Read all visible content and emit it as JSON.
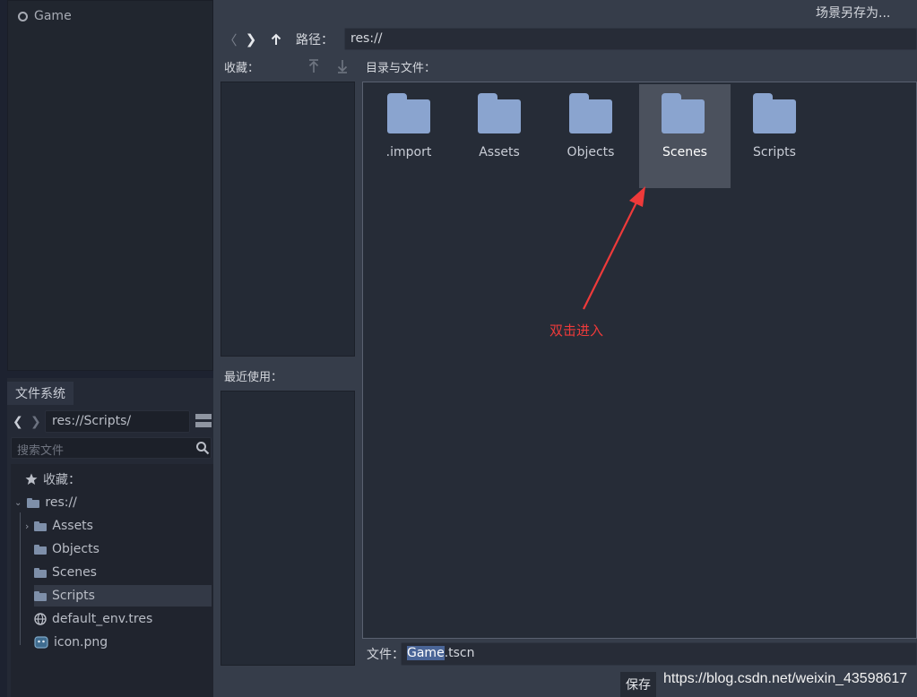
{
  "scene_tree": {
    "root_node": "Game"
  },
  "filesystem": {
    "tab_label": "文件系统",
    "current_path": "res://Scripts/",
    "search_placeholder": "搜索文件",
    "tree": {
      "favorites_label": "收藏：",
      "root_label": "res://",
      "items": [
        {
          "label": "Assets",
          "icon": "folder-icon",
          "expandable": true
        },
        {
          "label": "Objects",
          "icon": "folder-icon"
        },
        {
          "label": "Scenes",
          "icon": "folder-icon"
        },
        {
          "label": "Scripts",
          "icon": "folder-icon",
          "selected": true
        },
        {
          "label": "default_env.tres",
          "icon": "globe-icon"
        },
        {
          "label": "icon.png",
          "icon": "image-icon"
        }
      ]
    }
  },
  "dialog": {
    "title": "场景另存为...",
    "path_label": "路径：",
    "path_value": "res://",
    "favorites_label": "收藏：",
    "recent_label": "最近使用：",
    "dir_label": "目录与文件：",
    "folders": [
      {
        "label": ".import"
      },
      {
        "label": "Assets"
      },
      {
        "label": "Objects"
      },
      {
        "label": "Scenes",
        "selected": true
      },
      {
        "label": "Scripts"
      }
    ],
    "file_label": "文件：",
    "file_name_highlight": "Game",
    "file_name_ext": ".tscn",
    "save_label": "保存"
  },
  "annotation": {
    "text": "双击进入",
    "color": "#ee3a3a"
  },
  "watermark": "https://blog.csdn.net/weixin_43598617",
  "colors": {
    "folder": "#8aa4cf",
    "selection": "#4b515d",
    "text_highlight": "#4a6597"
  }
}
